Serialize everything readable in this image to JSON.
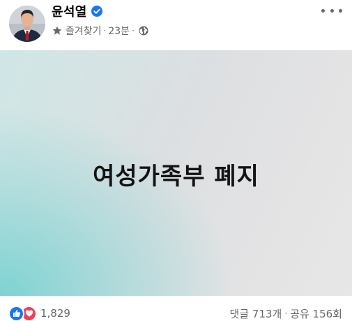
{
  "post": {
    "author": {
      "name": "윤석열",
      "verified_icon": "verified-badge-icon"
    },
    "meta": {
      "favorites_label": "즐겨찾기",
      "separator": "·",
      "time": "23분",
      "audience_icon": "globe-icon"
    },
    "image": {
      "text": "여성가족부 폐지",
      "colors": {
        "teal": "#7ad2d2",
        "grey": "#e5e5e5",
        "text": "#141414"
      }
    },
    "reactions": {
      "icons": [
        "like-icon",
        "love-icon"
      ],
      "count": "1,829"
    },
    "stats": {
      "comments": "댓글 713개",
      "separator": "·",
      "shares": "공유 156회"
    }
  },
  "colors": {
    "brand_blue": "#1877f2",
    "love_red": "#f33e58",
    "secondary_text": "#65676b"
  }
}
